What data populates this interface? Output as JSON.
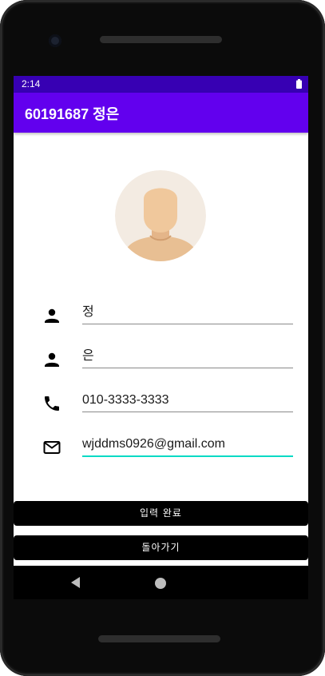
{
  "status_bar": {
    "time": "2:14",
    "battery_icon": "battery-icon"
  },
  "app_bar": {
    "title": "60191687 정은"
  },
  "profile": {
    "avatar_icon": "avatar-icon"
  },
  "form": {
    "fields": [
      {
        "icon": "person-icon",
        "value": "정"
      },
      {
        "icon": "person-icon",
        "value": "은"
      },
      {
        "icon": "phone-icon",
        "value": "010-3333-3333"
      },
      {
        "icon": "email-icon",
        "value": "wjddms0926@gmail.com"
      }
    ]
  },
  "buttons": {
    "submit_label": "입력 완료",
    "back_label": "돌아가기"
  },
  "colors": {
    "status_bar": "#3700b3",
    "app_bar": "#6200ee",
    "focus_underline": "#03dac5",
    "button_bg": "#000000"
  }
}
